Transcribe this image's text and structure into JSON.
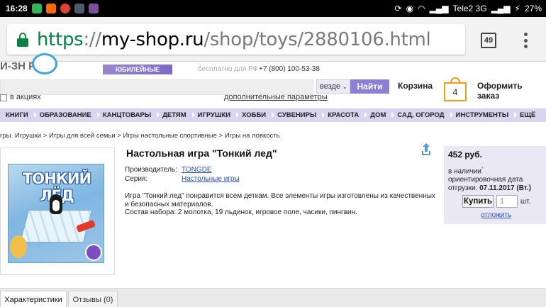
{
  "status_bar": {
    "time": "16:28",
    "carrier": "Tele2 3G",
    "battery": "27%",
    "colors": {
      "bg": "#000000",
      "fg": "#ffffff"
    }
  },
  "browser": {
    "url_scheme": "https",
    "url_sep": "://",
    "url_host": "my-shop.ru",
    "url_path": "/shop/toys/2880106.html",
    "tab_count": "49"
  },
  "header": {
    "logo_fragment": "И-ЗН         Р.RU",
    "jubilee_banner": "ЮБИЛЕЙНЫЕ СКИДКИ",
    "free_call": "бесплатно для РФ",
    "phone": "+7 (800) 100-53-38"
  },
  "search": {
    "scope": "везде",
    "button_label": "Найти",
    "promo_label": "в акциях",
    "params_link": "дополнительные параметры"
  },
  "cart": {
    "label": "Корзина",
    "count": "4",
    "checkout_label": "Оформить заказ",
    "accent": "#f29b1e"
  },
  "nav": {
    "items": [
      "КНИГИ",
      "ОБРАЗОВАНИЕ",
      "КАНЦТОВАРЫ",
      "ДЕТЯМ",
      "ИГРУШКИ",
      "ХОББИ",
      "СУВЕНИРЫ",
      "КРАСОТА",
      "ДОМ",
      "САД, ОГОРОД",
      "ИНСТРУМЕНТЫ",
      "ЕЩЁ"
    ],
    "bg": "#d9d4f0"
  },
  "breadcrumb": {
    "items": [
      "гры. Игрушки",
      "Игры для всей семьи",
      "Игры настольные спортивные",
      "Игры на ловкость"
    ],
    "separator": ">"
  },
  "product": {
    "title": "Настольная игра \"Тонкий лед\"",
    "box_title": "ТОНКИЙ ЛЁД",
    "manufacturer_label": "Производитель:",
    "manufacturer": "TONGDE",
    "series_label": "Серия:",
    "series": "Настольные игры",
    "description": "Игра \"Тонкий лед\" понравится всем деткам. Все элементы игры изготовлены из качественных и безопасных материалов.",
    "contents": "Состав набора: 2 молотка, 19 льдинок, игровое поле, часики, пингвин."
  },
  "buy": {
    "price": "452 руб.",
    "availability": "в наличии",
    "star": "*",
    "ship_label": "ориентировочная дата отгрузки:",
    "ship_date": "07.11.2017 (Вт.)",
    "buy_label": "Купить",
    "qty": "1",
    "unit": "шт.",
    "postpone": "отложить",
    "panel_bg": "#ebe8f6"
  },
  "tabs": [
    {
      "label": "Характеристики"
    },
    {
      "label": "Отзывы (0)"
    }
  ]
}
